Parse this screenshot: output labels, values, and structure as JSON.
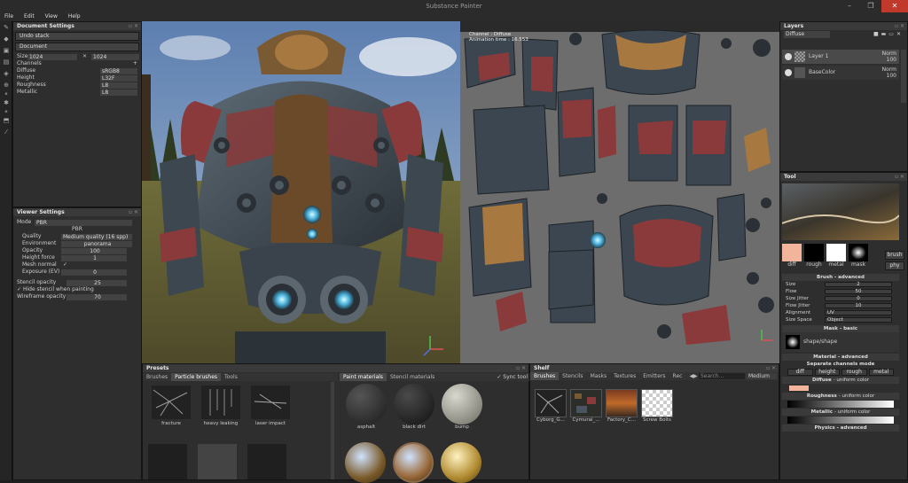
{
  "app": {
    "title": "Substance Painter",
    "win_min": "–",
    "win_max": "❐",
    "win_close": "✕"
  },
  "menu": [
    "File",
    "Edit",
    "View",
    "Help"
  ],
  "doc": {
    "title": "Document Settings",
    "undo": "Undo stack",
    "document": "Document",
    "size_label": "Size",
    "size_a": "1024",
    "size_b": "1024",
    "size_x": "✕",
    "channels_label": "Channels",
    "add": "+",
    "channels": [
      {
        "name": "Diffuse",
        "fmt": "sRGB8"
      },
      {
        "name": "Height",
        "fmt": "L32F"
      },
      {
        "name": "Roughness",
        "fmt": "L8"
      },
      {
        "name": "Metallic",
        "fmt": "L8"
      }
    ]
  },
  "viewer": {
    "title": "Viewer Settings",
    "mode_label": "Mode",
    "mode": "PBR",
    "shader": "PBR",
    "rows": [
      {
        "label": "Quality",
        "value": "Medium quality (16 spp)"
      },
      {
        "label": "Environment",
        "value": "panorama"
      },
      {
        "label": "Opacity",
        "value": "100"
      },
      {
        "label": "Height force",
        "value": "1"
      },
      {
        "label": "Mesh normal",
        "value": "✓"
      },
      {
        "label": "Exposure (EV)",
        "value": "0"
      }
    ],
    "stencil_label": "Stencil opacity",
    "stencil_val": "25",
    "hide_stencil": "Hide stencil when painting",
    "hide_stencil_check": "✓",
    "wire_label": "Wireframe opacity",
    "wire_val": "70"
  },
  "uv": {
    "line1": "Channel : Diffuse",
    "line2": "Animation time : 16.553"
  },
  "presets": {
    "title": "Presets",
    "tabs": [
      "Brushes",
      "Particle brushes",
      "Tools"
    ],
    "mat_tabs": [
      "Paint materials",
      "Stencil materials"
    ],
    "sync_check": "✓",
    "sync": "Sync tool",
    "brushes": [
      "fracture",
      "heavy leaking",
      "laser impact"
    ],
    "materials": [
      "asphalt",
      "black dirt",
      "bump"
    ]
  },
  "shelf": {
    "title": "Shelf",
    "tabs": [
      "Brushes",
      "Stencils",
      "Masks",
      "Textures",
      "Emitters",
      "Rec"
    ],
    "search": "Search...",
    "quality": "Medium",
    "arrows": "◀▶",
    "items": [
      "Cyborg_G...",
      "Cymurai_...",
      "Factory_C...",
      "Screw Bolts"
    ]
  },
  "layers": {
    "title": "Layers",
    "channel": "Diffuse",
    "items": [
      {
        "name": "Layer 1",
        "mode": "Norm",
        "opacity": "100"
      },
      {
        "name": "BaseColor",
        "mode": "Norm",
        "opacity": "100"
      }
    ]
  },
  "tool": {
    "title": "Tool",
    "channels": [
      "diff",
      "rough",
      "metal",
      "mask"
    ],
    "brush_btn": "brush",
    "phy_btn": "phy",
    "brush_adv": "Brush - advanced",
    "params": [
      {
        "label": "Size",
        "value": "2"
      },
      {
        "label": "Flow",
        "value": "50"
      },
      {
        "label": "Size Jitter",
        "value": "0"
      },
      {
        "label": "Flow Jitter",
        "value": "10"
      },
      {
        "label": "Alignment",
        "value": "UV"
      },
      {
        "label": "Size Space",
        "value": "Object"
      }
    ],
    "mask_basic": "Mask - basic",
    "mask_shape": "shape/shape",
    "mat_adv": "Material - advanced",
    "sep_mode": "Separate channels mode",
    "ch_buttons": [
      "diff",
      "height",
      "rough",
      "metal"
    ],
    "diffuse": "Diffuse",
    "uniform": "- uniform color",
    "roughness": "Roughness",
    "metallic": "Metallic",
    "physics": "Physics - advanced"
  },
  "colors": {
    "accent": "#4fb6e0",
    "armor_red": "#8a3a3a",
    "swatch": "#f2b49a"
  }
}
